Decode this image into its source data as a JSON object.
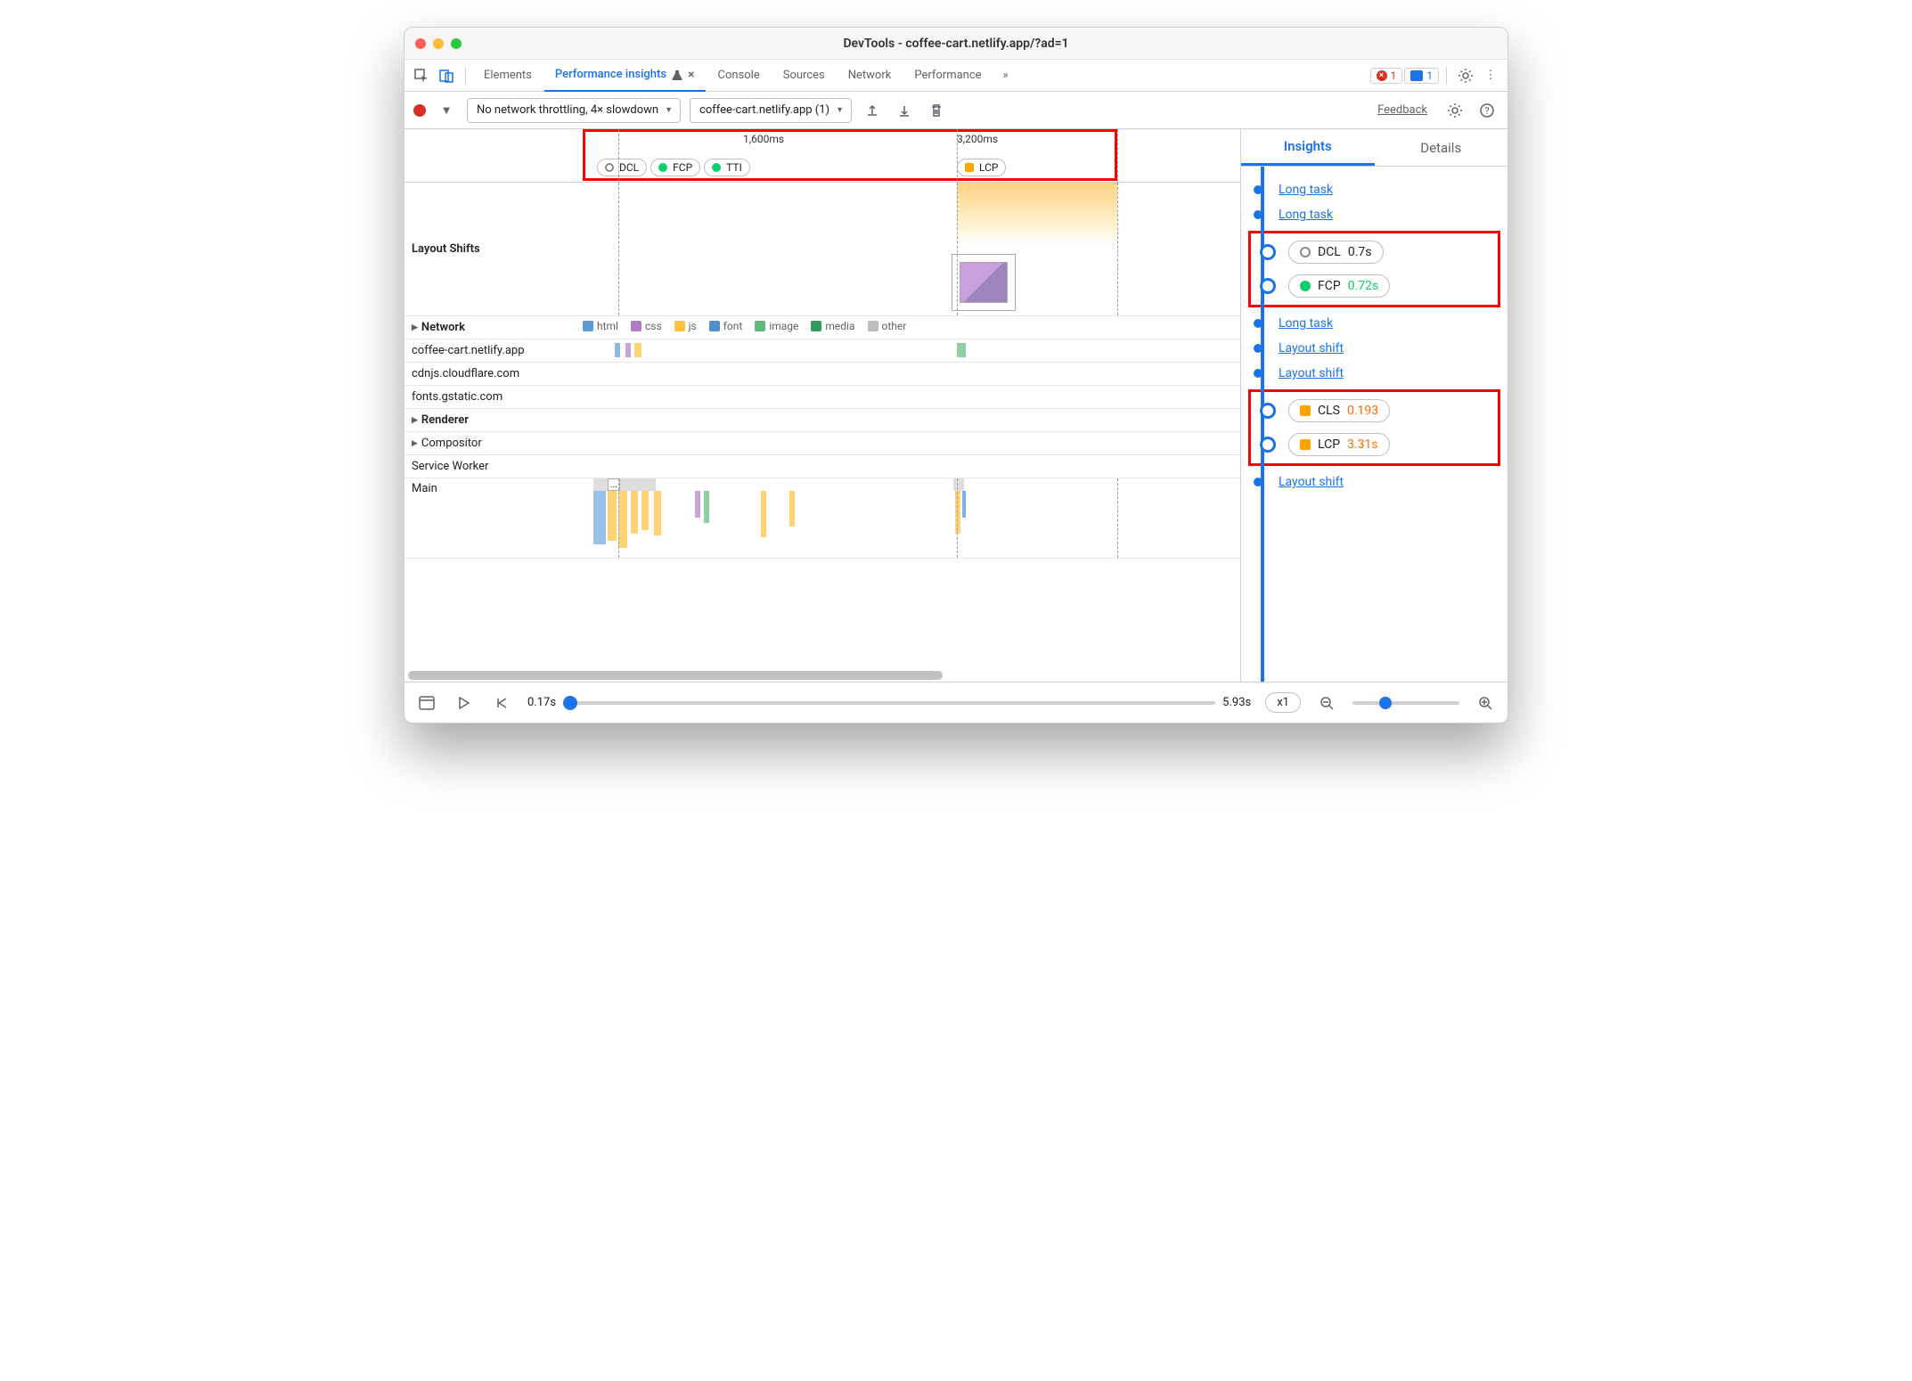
{
  "titlebar": {
    "title": "DevTools - coffee-cart.netlify.app/?ad=1"
  },
  "tabs": {
    "items": [
      "Elements",
      "Performance insights",
      "Console",
      "Sources",
      "Network",
      "Performance"
    ],
    "active": 1,
    "error_count": "1",
    "info_count": "1"
  },
  "toolbar": {
    "throttle": "No network throttling, 4× slowdown",
    "recording": "coffee-cart.netlify.app (1)",
    "feedback": "Feedback"
  },
  "ruler": {
    "ticks": [
      "1,600ms",
      "3,200ms"
    ],
    "group1": [
      {
        "label": "DCL",
        "marker": "ring"
      },
      {
        "label": "FCP",
        "marker": "green"
      },
      {
        "label": "TTI",
        "marker": "green"
      }
    ],
    "group2": [
      {
        "label": "LCP",
        "marker": "orange"
      }
    ]
  },
  "lanes": {
    "layout_shifts": "Layout Shifts",
    "network": "Network",
    "renderer": "Renderer",
    "compositor": "Compositor",
    "service_worker": "Service Worker",
    "main_thread": "Main",
    "network_rows": [
      "coffee-cart.netlify.app",
      "cdnjs.cloudflare.com",
      "fonts.gstatic.com"
    ]
  },
  "legend": {
    "items": [
      {
        "label": "html",
        "color": "#5b9bd5"
      },
      {
        "label": "css",
        "color": "#b07cc6"
      },
      {
        "label": "js",
        "color": "#ffc13b"
      },
      {
        "label": "font",
        "color": "#4f90cd"
      },
      {
        "label": "image",
        "color": "#5fba7d"
      },
      {
        "label": "media",
        "color": "#2e9e5b"
      },
      {
        "label": "other",
        "color": "#bdbdbd"
      }
    ]
  },
  "insights": {
    "tabs": [
      "Insights",
      "Details"
    ],
    "items": [
      {
        "kind": "link",
        "text": "Long task"
      },
      {
        "kind": "link",
        "text": "Long task"
      },
      {
        "kind": "pill",
        "marker": "ring",
        "label": "DCL",
        "value": "0.7s",
        "vclass": ""
      },
      {
        "kind": "pill",
        "marker": "green",
        "label": "FCP",
        "value": "0.72s",
        "vclass": "green"
      },
      {
        "kind": "link",
        "text": "Long task"
      },
      {
        "kind": "link",
        "text": "Layout shift"
      },
      {
        "kind": "link",
        "text": "Layout shift"
      },
      {
        "kind": "pill",
        "marker": "orange",
        "label": "CLS",
        "value": "0.193",
        "vclass": "orange"
      },
      {
        "kind": "pill",
        "marker": "orange",
        "label": "LCP",
        "value": "3.31s",
        "vclass": "orange"
      },
      {
        "kind": "link",
        "text": "Layout shift"
      }
    ]
  },
  "bottom": {
    "start": "0.17s",
    "end": "5.93s",
    "speed": "x1"
  }
}
